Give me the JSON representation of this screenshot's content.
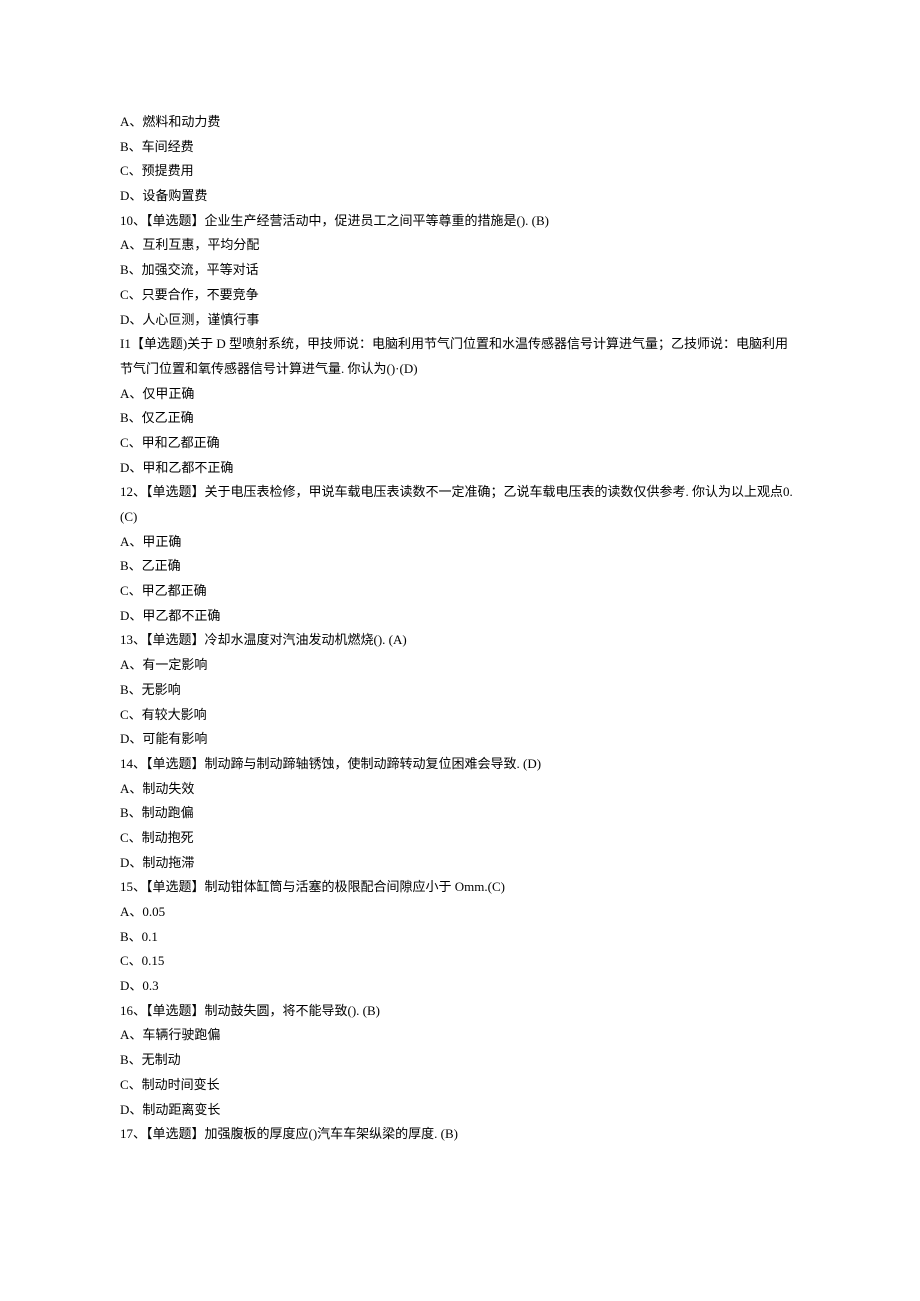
{
  "lines": [
    "A、燃料和动力费",
    "B、车间经费",
    "C、预提费用",
    "D、设备购置费",
    "10、【单选题】企业生产经营活动中，促进员工之间平等尊重的措施是(). (B)",
    "A、互利互惠，平均分配",
    "B、加强交流，平等对话",
    "C、只要合作，不要竞争",
    "D、人心叵测，谨慎行事",
    "I1【单选题)关于 D 型喷射系统，甲技师说：电脑利用节气门位置和水温传感器信号计算进气量；乙技师说：电脑利用节气门位置和氧传感器信号计算进气量. 你认为()·(D)",
    "A、仅甲正确",
    "B、仅乙正确",
    "C、甲和乙都正确",
    "D、甲和乙都不正确",
    "12、【单选题】关于电压表检修，甲说车载电压表读数不一定准确；乙说车载电压表的读数仅供参考. 你认为以上观点0.(C)",
    "A、甲正确",
    "B、乙正确",
    "C、甲乙都正确",
    "D、甲乙都不正确",
    "13、【单选题】冷却水温度对汽油发动机燃烧(). (A)",
    "A、有一定影响",
    "B、无影响",
    "C、有较大影响",
    "D、可能有影响",
    "14、【单选题】制动蹄与制动蹄轴锈蚀，使制动蹄转动复位困难会导致. (D)",
    "A、制动失效",
    "B、制动跑偏",
    "C、制动抱死",
    "D、制动拖滞",
    "15、【单选题】制动钳体缸筒与活塞的极限配合间隙应小于 Omm.(C)",
    "A、0.05",
    "B、0.1",
    "C、0.15",
    "D、0.3",
    "16、【单选题】制动鼓失圆，将不能导致(). (B)",
    "A、车辆行驶跑偏",
    "B、无制动",
    "C、制动时间变长",
    "D、制动距离变长",
    "17、【单选题】加强腹板的厚度应()汽车车架纵梁的厚度. (B)"
  ]
}
